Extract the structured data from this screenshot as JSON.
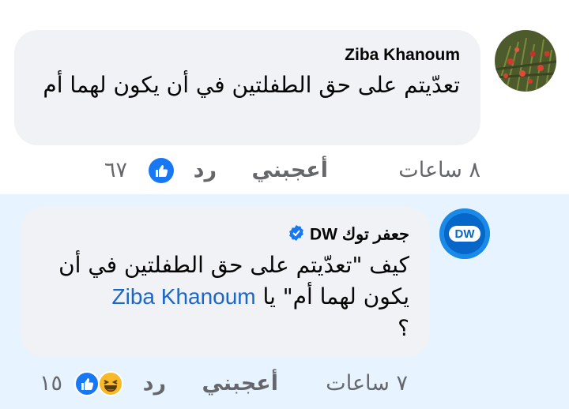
{
  "comments": [
    {
      "author": "Ziba Khanoum",
      "text": "تعدّيتم على حق الطفلتين في أن يكون لهما أم",
      "actions": {
        "time": "٨ ساعات",
        "like": "أعجبني",
        "reply": "رد",
        "reactions_count": "٦٧"
      },
      "reactions": [
        "like-reaction-icon"
      ]
    },
    {
      "author": "جعفر توك DW",
      "verified": true,
      "text_before_mention": "كيف \"تعدّيتم على حق الطفلتين في أن يكون لهما أم\" يا",
      "mention": "Ziba Khanoum",
      "text_after_mention": "؟",
      "actions": {
        "time": "٧ ساعات",
        "like": "أعجبني",
        "reply": "رد",
        "reactions_count": "١٥"
      },
      "reactions": [
        "haha-reaction-icon",
        "like-reaction-icon"
      ],
      "avatar_label": "DW"
    }
  ],
  "colors": {
    "bubble": "#f0f2f5",
    "highlight_bg": "#e7f3ff",
    "mention": "#1b66c9",
    "meta": "#65676b",
    "like_blue": "#1877f2",
    "haha_yellow": "#f7b928"
  }
}
